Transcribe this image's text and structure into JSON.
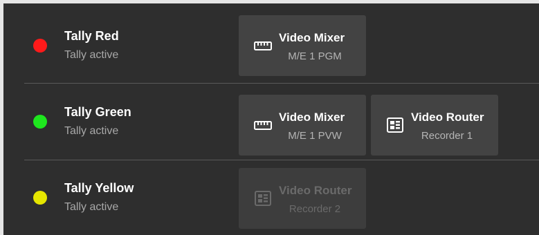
{
  "tallies": [
    {
      "name": "Tally Red",
      "status": "Tally active",
      "color": "#ff1a1a",
      "sources": [
        {
          "icon": "video-mixer-icon",
          "title": "Video Mixer",
          "subtitle": "M/E 1 PGM",
          "enabled": true
        }
      ]
    },
    {
      "name": "Tally Green",
      "status": "Tally active",
      "color": "#1ee61e",
      "sources": [
        {
          "icon": "video-mixer-icon",
          "title": "Video Mixer",
          "subtitle": "M/E 1 PVW",
          "enabled": true
        },
        {
          "icon": "video-router-icon",
          "title": "Video Router",
          "subtitle": "Recorder 1",
          "enabled": true
        }
      ]
    },
    {
      "name": "Tally Yellow",
      "status": "Tally active",
      "color": "#e6e600",
      "sources": [
        {
          "icon": "video-router-icon",
          "title": "Video Router",
          "subtitle": "Recorder 2",
          "enabled": false
        }
      ]
    }
  ]
}
